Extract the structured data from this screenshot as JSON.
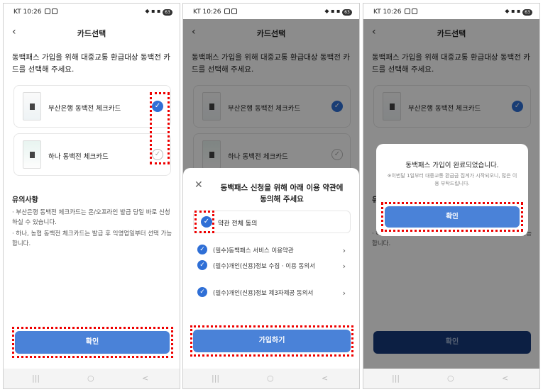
{
  "status": {
    "carrier_time": "KT 10:26",
    "battery": "63"
  },
  "page": {
    "title": "카드선택",
    "back_icon": "‹"
  },
  "description": "동백패스 가입을 위해 대중교통 환급대상 동백전 카드를 선택해 주세요.",
  "cards": [
    {
      "name": "부산은행 동백전 체크카드",
      "selected": true
    },
    {
      "name": "하나 동백전 체크카드",
      "selected": false
    }
  ],
  "notes": {
    "title": "유의사항",
    "items": [
      "· 부산은행 동백전 체크카드는 온/오프라인 발급 당일 바로 신청하실 수 있습니다.",
      "· 하나, 농협 동백전 체크카드는 발급 후 익영업일부터 선택 가능합니다."
    ]
  },
  "confirm_label": "확인",
  "sheet": {
    "title": "동백패스 신청을 위해 아래 이용 약관에 동의해 주세요",
    "agree_all": "약관 전체 동의",
    "terms": [
      "(필수)동백패스 서비스 이용약관",
      "(필수)개인(신용)정보 수집 · 이용 동의서",
      "(필수)개인(신용)정보 제3자제공 동의서"
    ],
    "join_label": "가입하기"
  },
  "dialog": {
    "title": "동백패스 가입이 완료되었습니다.",
    "subtitle": "※이번달 1일부터 대중교통 환급금 집계가 시작되오니, 많은 이용 부탁드립니다.",
    "confirm_label": "확인"
  },
  "colors": {
    "accent": "#4a82d8",
    "highlight": "#e00000"
  },
  "icons": {
    "check": "✓",
    "close": "✕",
    "chevron": "›"
  }
}
